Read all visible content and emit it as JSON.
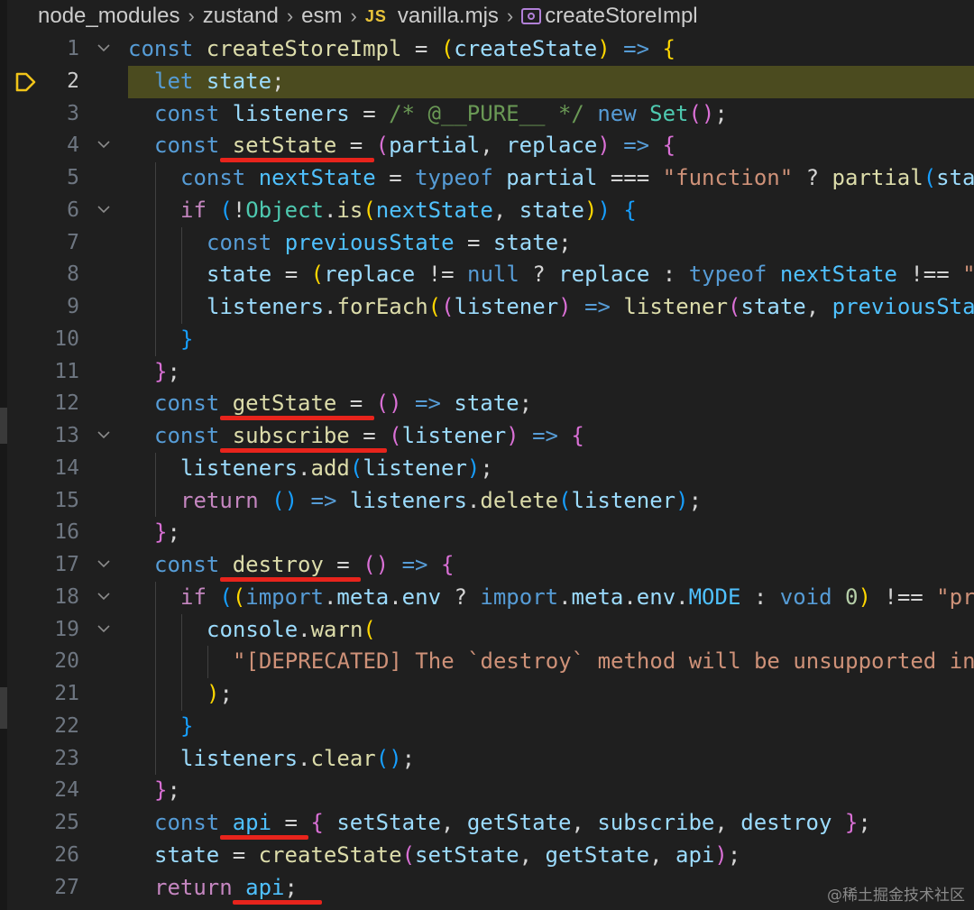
{
  "breadcrumb": {
    "items": [
      "node_modules",
      "zustand",
      "esm",
      "vanilla.mjs",
      "createStoreImpl"
    ],
    "file_icon": "JS"
  },
  "editor": {
    "current_line": 2,
    "lines": [
      {
        "n": 1,
        "fold": true,
        "indent": 0,
        "tokens": [
          [
            "kw",
            "const"
          ],
          [
            "punc",
            " "
          ],
          [
            "fn",
            "createStoreImpl"
          ],
          [
            "punc",
            " = "
          ],
          [
            "b1",
            "("
          ],
          [
            "var",
            "createState"
          ],
          [
            "b1",
            ")"
          ],
          [
            "punc",
            " "
          ],
          [
            "kw",
            "=>"
          ],
          [
            "punc",
            " "
          ],
          [
            "b1",
            "{"
          ]
        ]
      },
      {
        "n": 2,
        "fold": false,
        "indent": 1,
        "tokens": [
          [
            "kw",
            "let"
          ],
          [
            "punc",
            " "
          ],
          [
            "var",
            "state"
          ],
          [
            "punc",
            ";"
          ]
        ]
      },
      {
        "n": 3,
        "fold": false,
        "indent": 1,
        "tokens": [
          [
            "kw",
            "const"
          ],
          [
            "punc",
            " "
          ],
          [
            "var",
            "listeners"
          ],
          [
            "punc",
            " = "
          ],
          [
            "cmt",
            "/* @__PURE__ */"
          ],
          [
            "punc",
            " "
          ],
          [
            "kw",
            "new"
          ],
          [
            "punc",
            " "
          ],
          [
            "cls",
            "Set"
          ],
          [
            "b2",
            "()"
          ],
          [
            "punc",
            ";"
          ]
        ]
      },
      {
        "n": 4,
        "fold": true,
        "indent": 1,
        "tokens": [
          [
            "kw",
            "const"
          ],
          [
            "punc",
            " "
          ],
          [
            "fn",
            "setState"
          ],
          [
            "punc",
            " = "
          ],
          [
            "b2",
            "("
          ],
          [
            "var",
            "partial"
          ],
          [
            "punc",
            ", "
          ],
          [
            "var",
            "replace"
          ],
          [
            "b2",
            ")"
          ],
          [
            "punc",
            " "
          ],
          [
            "kw",
            "=>"
          ],
          [
            "punc",
            " "
          ],
          [
            "b2",
            "{"
          ]
        ]
      },
      {
        "n": 5,
        "fold": false,
        "indent": 2,
        "tokens": [
          [
            "kw",
            "const"
          ],
          [
            "punc",
            " "
          ],
          [
            "const",
            "nextState"
          ],
          [
            "punc",
            " = "
          ],
          [
            "kw",
            "typeof"
          ],
          [
            "punc",
            " "
          ],
          [
            "var",
            "partial"
          ],
          [
            "punc",
            " === "
          ],
          [
            "str",
            "\"function\""
          ],
          [
            "punc",
            " ? "
          ],
          [
            "fn",
            "partial"
          ],
          [
            "b3",
            "("
          ],
          [
            "var",
            "state"
          ],
          [
            "b3",
            ")"
          ]
        ]
      },
      {
        "n": 6,
        "fold": true,
        "indent": 2,
        "tokens": [
          [
            "ctl",
            "if"
          ],
          [
            "punc",
            " "
          ],
          [
            "b3",
            "("
          ],
          [
            "punc",
            "!"
          ],
          [
            "cls",
            "Object"
          ],
          [
            "punc",
            "."
          ],
          [
            "fn",
            "is"
          ],
          [
            "b1",
            "("
          ],
          [
            "const",
            "nextState"
          ],
          [
            "punc",
            ", "
          ],
          [
            "var",
            "state"
          ],
          [
            "b1",
            ")"
          ],
          [
            "b3",
            ")"
          ],
          [
            "punc",
            " "
          ],
          [
            "b3",
            "{"
          ]
        ]
      },
      {
        "n": 7,
        "fold": false,
        "indent": 3,
        "tokens": [
          [
            "kw",
            "const"
          ],
          [
            "punc",
            " "
          ],
          [
            "const",
            "previousState"
          ],
          [
            "punc",
            " = "
          ],
          [
            "var",
            "state"
          ],
          [
            "punc",
            ";"
          ]
        ]
      },
      {
        "n": 8,
        "fold": false,
        "indent": 3,
        "tokens": [
          [
            "var",
            "state"
          ],
          [
            "punc",
            " = "
          ],
          [
            "b1",
            "("
          ],
          [
            "var",
            "replace"
          ],
          [
            "punc",
            " != "
          ],
          [
            "kw",
            "null"
          ],
          [
            "punc",
            " ? "
          ],
          [
            "var",
            "replace"
          ],
          [
            "punc",
            " : "
          ],
          [
            "kw",
            "typeof"
          ],
          [
            "punc",
            " "
          ],
          [
            "const",
            "nextState"
          ],
          [
            "punc",
            " !== "
          ],
          [
            "str",
            "\"object\""
          ]
        ]
      },
      {
        "n": 9,
        "fold": false,
        "indent": 3,
        "tokens": [
          [
            "var",
            "listeners"
          ],
          [
            "punc",
            "."
          ],
          [
            "fn",
            "forEach"
          ],
          [
            "b1",
            "("
          ],
          [
            "b2",
            "("
          ],
          [
            "var",
            "listener"
          ],
          [
            "b2",
            ")"
          ],
          [
            "punc",
            " "
          ],
          [
            "kw",
            "=>"
          ],
          [
            "punc",
            " "
          ],
          [
            "fn",
            "listener"
          ],
          [
            "b2",
            "("
          ],
          [
            "var",
            "state"
          ],
          [
            "punc",
            ", "
          ],
          [
            "const",
            "previousState"
          ],
          [
            "b2",
            ")"
          ]
        ]
      },
      {
        "n": 10,
        "fold": false,
        "indent": 2,
        "tokens": [
          [
            "b3",
            "}"
          ]
        ]
      },
      {
        "n": 11,
        "fold": false,
        "indent": 1,
        "tokens": [
          [
            "b2",
            "}"
          ],
          [
            "punc",
            ";"
          ]
        ]
      },
      {
        "n": 12,
        "fold": false,
        "indent": 1,
        "tokens": [
          [
            "kw",
            "const"
          ],
          [
            "punc",
            " "
          ],
          [
            "fn",
            "getState"
          ],
          [
            "punc",
            " = "
          ],
          [
            "b2",
            "()"
          ],
          [
            "punc",
            " "
          ],
          [
            "kw",
            "=>"
          ],
          [
            "punc",
            " "
          ],
          [
            "var",
            "state"
          ],
          [
            "punc",
            ";"
          ]
        ]
      },
      {
        "n": 13,
        "fold": true,
        "indent": 1,
        "tokens": [
          [
            "kw",
            "const"
          ],
          [
            "punc",
            " "
          ],
          [
            "fn",
            "subscribe"
          ],
          [
            "punc",
            " = "
          ],
          [
            "b2",
            "("
          ],
          [
            "var",
            "listener"
          ],
          [
            "b2",
            ")"
          ],
          [
            "punc",
            " "
          ],
          [
            "kw",
            "=>"
          ],
          [
            "punc",
            " "
          ],
          [
            "b2",
            "{"
          ]
        ]
      },
      {
        "n": 14,
        "fold": false,
        "indent": 2,
        "tokens": [
          [
            "var",
            "listeners"
          ],
          [
            "punc",
            "."
          ],
          [
            "fn",
            "add"
          ],
          [
            "b3",
            "("
          ],
          [
            "var",
            "listener"
          ],
          [
            "b3",
            ")"
          ],
          [
            "punc",
            ";"
          ]
        ]
      },
      {
        "n": 15,
        "fold": false,
        "indent": 2,
        "tokens": [
          [
            "ctl",
            "return"
          ],
          [
            "punc",
            " "
          ],
          [
            "b3",
            "()"
          ],
          [
            "punc",
            " "
          ],
          [
            "kw",
            "=>"
          ],
          [
            "punc",
            " "
          ],
          [
            "var",
            "listeners"
          ],
          [
            "punc",
            "."
          ],
          [
            "fn",
            "delete"
          ],
          [
            "b3",
            "("
          ],
          [
            "var",
            "listener"
          ],
          [
            "b3",
            ")"
          ],
          [
            "punc",
            ";"
          ]
        ]
      },
      {
        "n": 16,
        "fold": false,
        "indent": 1,
        "tokens": [
          [
            "b2",
            "}"
          ],
          [
            "punc",
            ";"
          ]
        ]
      },
      {
        "n": 17,
        "fold": true,
        "indent": 1,
        "tokens": [
          [
            "kw",
            "const"
          ],
          [
            "punc",
            " "
          ],
          [
            "fn",
            "destroy"
          ],
          [
            "punc",
            " = "
          ],
          [
            "b2",
            "()"
          ],
          [
            "punc",
            " "
          ],
          [
            "kw",
            "=>"
          ],
          [
            "punc",
            " "
          ],
          [
            "b2",
            "{"
          ]
        ]
      },
      {
        "n": 18,
        "fold": true,
        "indent": 2,
        "tokens": [
          [
            "ctl",
            "if"
          ],
          [
            "punc",
            " "
          ],
          [
            "b3",
            "("
          ],
          [
            "b1",
            "("
          ],
          [
            "kw",
            "import"
          ],
          [
            "punc",
            "."
          ],
          [
            "var",
            "meta"
          ],
          [
            "punc",
            "."
          ],
          [
            "var",
            "env"
          ],
          [
            "punc",
            " ? "
          ],
          [
            "kw",
            "import"
          ],
          [
            "punc",
            "."
          ],
          [
            "var",
            "meta"
          ],
          [
            "punc",
            "."
          ],
          [
            "var",
            "env"
          ],
          [
            "punc",
            "."
          ],
          [
            "const",
            "MODE"
          ],
          [
            "punc",
            " : "
          ],
          [
            "kw",
            "void"
          ],
          [
            "punc",
            " "
          ],
          [
            "num",
            "0"
          ],
          [
            "b1",
            ")"
          ],
          [
            "punc",
            " !== "
          ],
          [
            "str",
            "\"production\""
          ]
        ]
      },
      {
        "n": 19,
        "fold": true,
        "indent": 3,
        "tokens": [
          [
            "var",
            "console"
          ],
          [
            "punc",
            "."
          ],
          [
            "fn",
            "warn"
          ],
          [
            "b1",
            "("
          ]
        ]
      },
      {
        "n": 20,
        "fold": false,
        "indent": 4,
        "tokens": [
          [
            "str",
            "\"[DEPRECATED] The `destroy` method will be unsupported in a future version\""
          ]
        ]
      },
      {
        "n": 21,
        "fold": false,
        "indent": 3,
        "tokens": [
          [
            "b1",
            ")"
          ],
          [
            "punc",
            ";"
          ]
        ]
      },
      {
        "n": 22,
        "fold": false,
        "indent": 2,
        "tokens": [
          [
            "b3",
            "}"
          ]
        ]
      },
      {
        "n": 23,
        "fold": false,
        "indent": 2,
        "tokens": [
          [
            "var",
            "listeners"
          ],
          [
            "punc",
            "."
          ],
          [
            "fn",
            "clear"
          ],
          [
            "b3",
            "()"
          ],
          [
            "punc",
            ";"
          ]
        ]
      },
      {
        "n": 24,
        "fold": false,
        "indent": 1,
        "tokens": [
          [
            "b2",
            "}"
          ],
          [
            "punc",
            ";"
          ]
        ]
      },
      {
        "n": 25,
        "fold": false,
        "indent": 1,
        "tokens": [
          [
            "kw",
            "const"
          ],
          [
            "punc",
            " "
          ],
          [
            "const",
            "api"
          ],
          [
            "punc",
            " = "
          ],
          [
            "b2",
            "{"
          ],
          [
            "punc",
            " "
          ],
          [
            "var",
            "setState"
          ],
          [
            "punc",
            ", "
          ],
          [
            "var",
            "getState"
          ],
          [
            "punc",
            ", "
          ],
          [
            "var",
            "subscribe"
          ],
          [
            "punc",
            ", "
          ],
          [
            "var",
            "destroy"
          ],
          [
            "punc",
            " "
          ],
          [
            "b2",
            "}"
          ],
          [
            "punc",
            ";"
          ]
        ]
      },
      {
        "n": 26,
        "fold": false,
        "indent": 1,
        "tokens": [
          [
            "var",
            "state"
          ],
          [
            "punc",
            " = "
          ],
          [
            "fn",
            "createState"
          ],
          [
            "b2",
            "("
          ],
          [
            "var",
            "setState"
          ],
          [
            "punc",
            ", "
          ],
          [
            "var",
            "getState"
          ],
          [
            "punc",
            ", "
          ],
          [
            "var",
            "api"
          ],
          [
            "b2",
            ")"
          ],
          [
            "punc",
            ";"
          ]
        ]
      },
      {
        "n": 27,
        "fold": false,
        "indent": 1,
        "tokens": [
          [
            "ctl",
            "return"
          ],
          [
            "punc",
            " "
          ],
          [
            "const",
            "api"
          ],
          [
            "punc",
            ";"
          ]
        ]
      }
    ]
  },
  "annotations": {
    "underline_color": "#e8241c",
    "underlined": [
      "setState",
      "getState",
      "subscribe",
      "destroy",
      "api"
    ]
  },
  "watermark": "@稀土掘金技术社区"
}
